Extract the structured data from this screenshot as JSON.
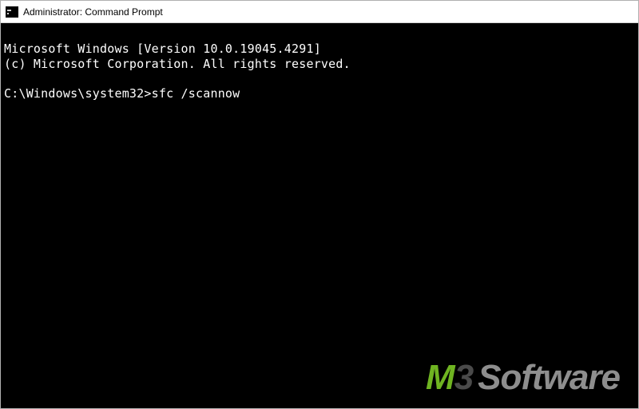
{
  "titlebar": {
    "title": "Administrator: Command Prompt"
  },
  "terminal": {
    "line1": "Microsoft Windows [Version 10.0.19045.4291]",
    "line2": "(c) Microsoft Corporation. All rights reserved.",
    "blank": "",
    "prompt": "C:\\Windows\\system32>",
    "command": "sfc /scannow"
  },
  "watermark": {
    "m": "M",
    "three": "3",
    "software": "Software"
  }
}
